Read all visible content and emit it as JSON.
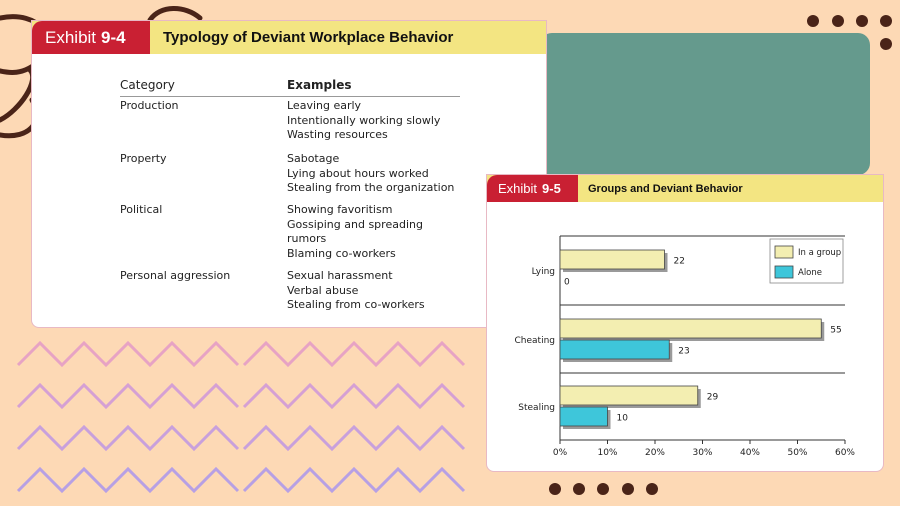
{
  "exhibit1": {
    "label": "Exhibit",
    "number": "9-4",
    "title": "Typology of Deviant Workplace Behavior",
    "headers": {
      "category": "Category",
      "examples": "Examples"
    },
    "rows": [
      {
        "category": "Production",
        "examples": [
          "Leaving early",
          "Intentionally working slowly",
          "Wasting resources"
        ]
      },
      {
        "category": "Property",
        "examples": [
          "Sabotage",
          "Lying about hours worked",
          "Stealing from the organization"
        ]
      },
      {
        "category": "Political",
        "examples": [
          "Showing favoritism",
          "Gossiping and spreading",
          "rumors",
          "Blaming co-workers"
        ]
      },
      {
        "category": "Personal aggression",
        "examples": [
          "Sexual harassment",
          "Verbal abuse",
          "Stealing from co-workers"
        ]
      }
    ]
  },
  "exhibit2": {
    "label": "Exhibit",
    "number": "9-5",
    "title": "Groups and Deviant Behavior"
  },
  "chart_data": {
    "type": "bar",
    "orientation": "horizontal",
    "categories": [
      "Lying",
      "Cheating",
      "Stealing"
    ],
    "series": [
      {
        "name": "In a group",
        "values": [
          22,
          55,
          29
        ],
        "color": "#f3eeb1"
      },
      {
        "name": "Alone",
        "values": [
          0,
          23,
          10
        ],
        "color": "#3ec6da"
      }
    ],
    "xlim": [
      0,
      60
    ],
    "xticks": [
      "0%",
      "10%",
      "20%",
      "30%",
      "40%",
      "50%",
      "60%"
    ],
    "grid": true,
    "legend": "top-right"
  },
  "colors": {
    "background": "#fdd9b5",
    "teal_panel": "#659a8d",
    "header_red": "#c92033",
    "header_yellow": "#f3e582"
  }
}
